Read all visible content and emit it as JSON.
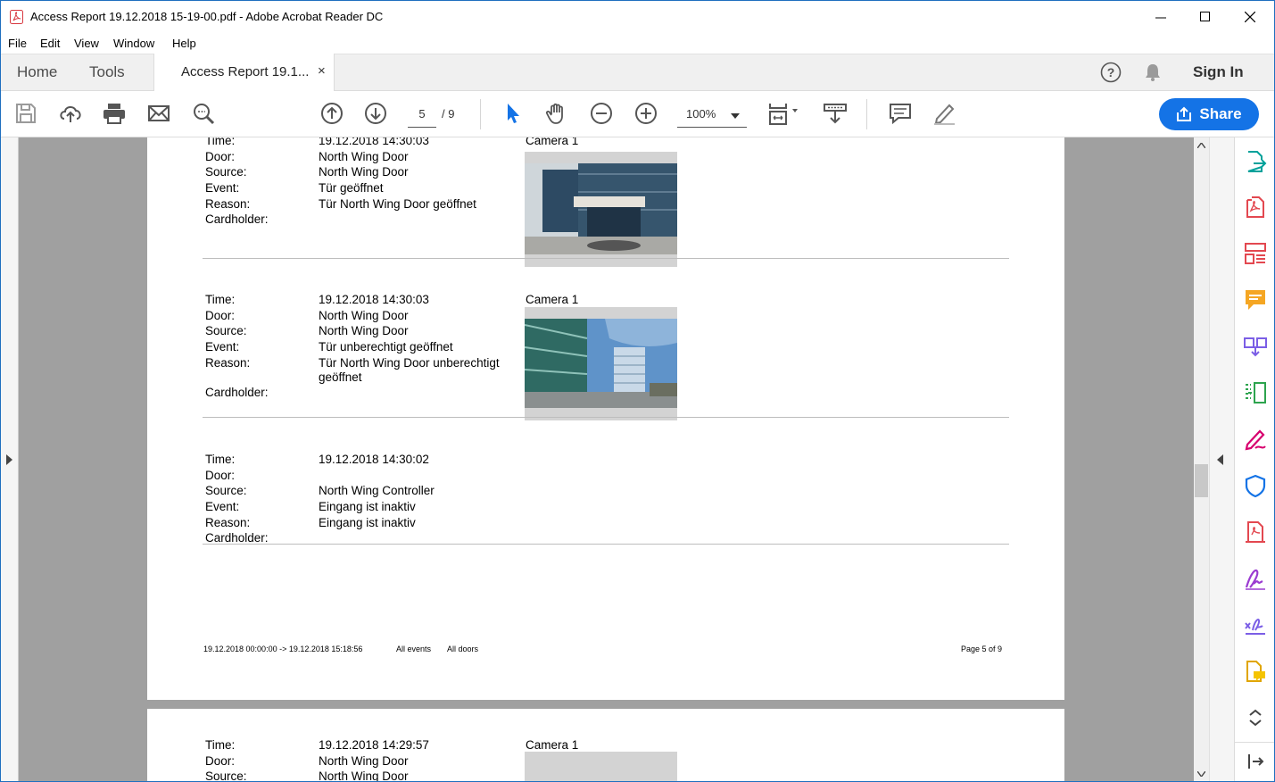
{
  "window": {
    "title": "Access Report 19.12.2018 15-19-00.pdf - Adobe Acrobat Reader DC"
  },
  "menu": [
    "File",
    "Edit",
    "View",
    "Window",
    "Help"
  ],
  "tabs": {
    "home": "Home",
    "tools": "Tools",
    "doc_tab": "Access Report 19.1...",
    "close": "×",
    "sign_in": "Sign In"
  },
  "toolbar": {
    "current_page": "5",
    "page_total": "/ 9",
    "zoom": "100%",
    "share_label": "Share"
  },
  "colors": {
    "accent": "#1473e6",
    "viewer_bg": "#a0a0a0"
  },
  "report": {
    "labels": {
      "time": "Time:",
      "door": "Door:",
      "source": "Source:",
      "event": "Event:",
      "reason": "Reason:",
      "cardholder": "Cardholder:"
    },
    "records": [
      {
        "time": "19.12.2018 14:30:03",
        "door": "North Wing Door",
        "source": "North Wing Door",
        "event": "Tür geöffnet",
        "reason": "Tür North Wing Door geöffnet",
        "camera": "Camera 1"
      },
      {
        "time": "19.12.2018 14:30:03",
        "door": "North Wing Door",
        "source": "North Wing Door",
        "event": "Tür unberechtigt geöffnet",
        "reason_line1": "Tür North Wing Door unberechtigt",
        "reason_line2": "geöffnet",
        "camera": "Camera 1"
      },
      {
        "time": "19.12.2018 14:30:02",
        "door": "",
        "source": "North Wing Controller",
        "event": "Eingang ist inaktiv",
        "reason": "Eingang ist inaktiv"
      },
      {
        "time": "19.12.2018 14:29:57",
        "door": "North Wing Door",
        "source": "North Wing Door",
        "camera": "Camera 1"
      }
    ],
    "footer": {
      "range": "19.12.2018 00:00:00 -> 19.12.2018 15:18:56",
      "events": "All events",
      "doors": "All doors",
      "page": "Page 5 of 9"
    }
  },
  "icons": {
    "toolbar": [
      "save-icon",
      "upload-icon",
      "print-icon",
      "email-icon",
      "search-icon",
      "page-up-icon",
      "page-down-icon",
      "select-pointer-icon",
      "hand-tool-icon",
      "zoom-out-icon",
      "zoom-in-icon",
      "fit-page-icon",
      "read-mode-icon",
      "comment-icon",
      "highlight-pen-icon"
    ],
    "right_panel": [
      "export-pdf-icon",
      "create-pdf-icon",
      "organize-pages-icon",
      "comment-tool-icon",
      "combine-files-icon",
      "compress-pdf-icon",
      "fill-sign-pen-icon",
      "protect-shield-icon",
      "pdf-tools-icon",
      "sign-icon",
      "fill-sign-icon",
      "send-for-comments-icon",
      "more-tools-icon",
      "collapse-panel-icon"
    ]
  }
}
